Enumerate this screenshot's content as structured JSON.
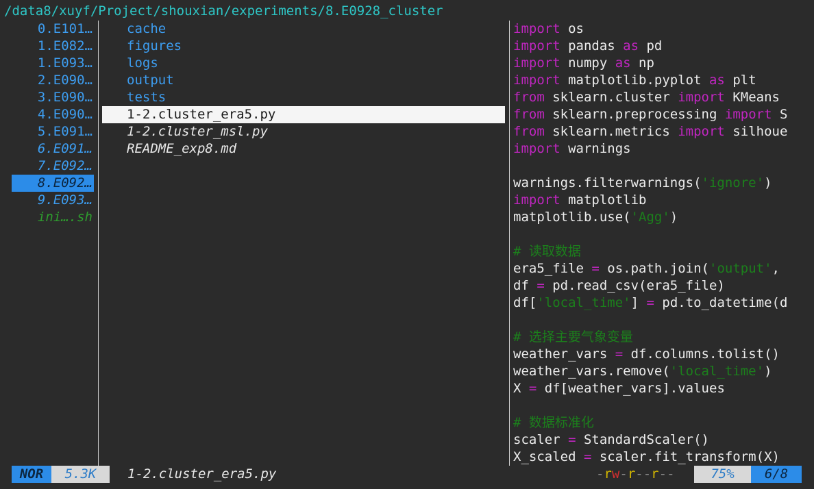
{
  "path": "/data8/xuyf/Project/shouxian/experiments/8.E0928_cluster",
  "parent_entries": [
    {
      "label": "0.E101…",
      "italic": false,
      "selected": false,
      "script": false
    },
    {
      "label": "1.E082…",
      "italic": false,
      "selected": false,
      "script": false
    },
    {
      "label": "1.E093…",
      "italic": false,
      "selected": false,
      "script": false
    },
    {
      "label": "2.E090…",
      "italic": false,
      "selected": false,
      "script": false
    },
    {
      "label": "3.E090…",
      "italic": false,
      "selected": false,
      "script": false
    },
    {
      "label": "4.E090…",
      "italic": false,
      "selected": false,
      "script": false
    },
    {
      "label": "5.E091…",
      "italic": false,
      "selected": false,
      "script": false
    },
    {
      "label": "6.E091…",
      "italic": true,
      "selected": false,
      "script": false
    },
    {
      "label": "7.E092…",
      "italic": true,
      "selected": false,
      "script": false
    },
    {
      "label": "8.E092…",
      "italic": true,
      "selected": true,
      "script": false
    },
    {
      "label": "9.E093…",
      "italic": true,
      "selected": false,
      "script": false
    },
    {
      "label": "ini….sh",
      "italic": true,
      "selected": false,
      "script": true
    }
  ],
  "current_entries": [
    {
      "label": "cache",
      "type": "dir",
      "active": false
    },
    {
      "label": "figures",
      "type": "dir",
      "active": false
    },
    {
      "label": "logs",
      "type": "dir",
      "active": false
    },
    {
      "label": "output",
      "type": "dir",
      "active": false
    },
    {
      "label": "tests",
      "type": "dir",
      "active": false
    },
    {
      "label": "1-2.cluster_era5.py",
      "type": "file",
      "active": true
    },
    {
      "label": "1-2.cluster_msl.py",
      "type": "file",
      "active": false
    },
    {
      "label": "README_exp8.md",
      "type": "file",
      "active": false
    }
  ],
  "preview_lines": [
    [
      [
        "kw",
        "import"
      ],
      [
        "tx",
        " os"
      ]
    ],
    [
      [
        "kw",
        "import"
      ],
      [
        "tx",
        " pandas "
      ],
      [
        "kw",
        "as"
      ],
      [
        "tx",
        " pd"
      ]
    ],
    [
      [
        "kw",
        "import"
      ],
      [
        "tx",
        " numpy "
      ],
      [
        "kw",
        "as"
      ],
      [
        "tx",
        " np"
      ]
    ],
    [
      [
        "kw",
        "import"
      ],
      [
        "tx",
        " matplotlib.pyplot "
      ],
      [
        "kw",
        "as"
      ],
      [
        "tx",
        " plt"
      ]
    ],
    [
      [
        "kw",
        "from"
      ],
      [
        "tx",
        " sklearn.cluster "
      ],
      [
        "kw",
        "import"
      ],
      [
        "tx",
        " KMeans"
      ]
    ],
    [
      [
        "kw",
        "from"
      ],
      [
        "tx",
        " sklearn.preprocessing "
      ],
      [
        "kw",
        "import"
      ],
      [
        "tx",
        " S"
      ]
    ],
    [
      [
        "kw",
        "from"
      ],
      [
        "tx",
        " sklearn.metrics "
      ],
      [
        "kw",
        "import"
      ],
      [
        "tx",
        " silhoue"
      ]
    ],
    [
      [
        "kw",
        "import"
      ],
      [
        "tx",
        " warnings"
      ]
    ],
    [],
    [
      [
        "tx",
        "warnings.filterwarnings("
      ],
      [
        "str",
        "'ignore'"
      ],
      [
        "tx",
        ")"
      ]
    ],
    [
      [
        "kw",
        "import"
      ],
      [
        "tx",
        " matplotlib"
      ]
    ],
    [
      [
        "tx",
        "matplotlib.use("
      ],
      [
        "str",
        "'Agg'"
      ],
      [
        "tx",
        ")"
      ]
    ],
    [],
    [
      [
        "cm",
        "# 读取数据"
      ]
    ],
    [
      [
        "tx",
        "era5_file "
      ],
      [
        "kw",
        "="
      ],
      [
        "tx",
        " os.path.join("
      ],
      [
        "str",
        "'output'"
      ],
      [
        "tx",
        ","
      ]
    ],
    [
      [
        "tx",
        "df "
      ],
      [
        "kw",
        "="
      ],
      [
        "tx",
        " pd.read_csv(era5_file)"
      ]
    ],
    [
      [
        "tx",
        "df["
      ],
      [
        "str",
        "'local_time'"
      ],
      [
        "tx",
        "] "
      ],
      [
        "kw",
        "="
      ],
      [
        "tx",
        " pd.to_datetime(d"
      ]
    ],
    [],
    [
      [
        "cm",
        "# 选择主要气象变量"
      ]
    ],
    [
      [
        "tx",
        "weather_vars "
      ],
      [
        "kw",
        "="
      ],
      [
        "tx",
        " df.columns.tolist()"
      ]
    ],
    [
      [
        "tx",
        "weather_vars.remove("
      ],
      [
        "str",
        "'local_time'"
      ],
      [
        "tx",
        ")"
      ]
    ],
    [
      [
        "tx",
        "X "
      ],
      [
        "kw",
        "="
      ],
      [
        "tx",
        " df[weather_vars].values"
      ]
    ],
    [],
    [
      [
        "cm",
        "# 数据标准化"
      ]
    ],
    [
      [
        "tx",
        "scaler "
      ],
      [
        "kw",
        "="
      ],
      [
        "tx",
        " StandardScaler()"
      ]
    ],
    [
      [
        "tx",
        "X_scaled "
      ],
      [
        "kw",
        "="
      ],
      [
        "tx",
        " scaler.fit_transform(X)"
      ]
    ]
  ],
  "status": {
    "mode": "NOR",
    "size": "5.3K",
    "filename": "1-2.cluster_era5.py",
    "perms": [
      [
        "d",
        "-"
      ],
      [
        "r",
        "r"
      ],
      [
        "w",
        "w"
      ],
      [
        "d",
        "-"
      ],
      [
        "r",
        "r"
      ],
      [
        "d",
        "-"
      ],
      [
        "d",
        "-"
      ],
      [
        "r",
        "r"
      ],
      [
        "d",
        "-"
      ],
      [
        "d",
        "-"
      ]
    ],
    "percent": "75%",
    "position": "6/8"
  },
  "colors": {
    "accent": "#2c8ce8",
    "dir": "#3d9df0",
    "path": "#2ec5c5",
    "keyword": "#c026c0",
    "string": "#1c7f1c"
  }
}
